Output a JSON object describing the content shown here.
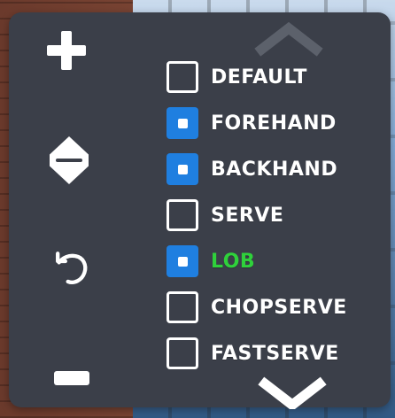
{
  "colors": {
    "panel_bg": "#3b3f49",
    "icon": "#ffffff",
    "checkbox_checked": "#1f7fe0",
    "label_default": "#ffffff",
    "label_active": "#2fd13b"
  },
  "controls": {
    "left": [
      {
        "id": "plus",
        "icon": "plus-icon"
      },
      {
        "id": "updown",
        "icon": "up-down-arrows-icon"
      },
      {
        "id": "reset",
        "icon": "undo-icon"
      },
      {
        "id": "minus",
        "icon": "minus-icon"
      }
    ],
    "scroll": {
      "up_icon": "chevron-up-icon",
      "down_icon": "chevron-down-icon"
    }
  },
  "list": {
    "items": [
      {
        "label": "DEFAULT",
        "checked": false,
        "active": false
      },
      {
        "label": "FOREHAND",
        "checked": true,
        "active": false
      },
      {
        "label": "BACKHAND",
        "checked": true,
        "active": false
      },
      {
        "label": "SERVE",
        "checked": false,
        "active": false
      },
      {
        "label": "LOB",
        "checked": true,
        "active": true
      },
      {
        "label": "CHOPSERVE",
        "checked": false,
        "active": false
      },
      {
        "label": "FASTSERVE",
        "checked": false,
        "active": false
      }
    ]
  }
}
